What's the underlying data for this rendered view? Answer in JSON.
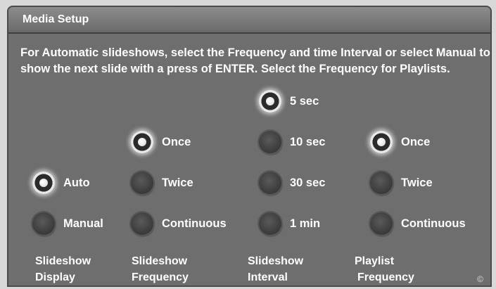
{
  "title": "Media Setup",
  "description": "For Automatic slideshows, select the Frequency and time Interval or select Manual to show the next slide with a press of ENTER. Select the Frequency for Playlists.",
  "columns": {
    "display": {
      "line1": "Slideshow",
      "line2": "Display"
    },
    "frequency": {
      "line1": "Slideshow",
      "line2": "Frequency"
    },
    "interval": {
      "line1": "Slideshow",
      "line2": "Interval"
    },
    "playlist": {
      "line1": "Playlist",
      "line2": "Frequency"
    }
  },
  "options": {
    "display": [
      {
        "label": "Auto",
        "selected": true
      },
      {
        "label": "Manual",
        "selected": false
      }
    ],
    "frequency": [
      {
        "label": "Once",
        "selected": true
      },
      {
        "label": "Twice",
        "selected": false
      },
      {
        "label": "Continuous",
        "selected": false
      }
    ],
    "interval": [
      {
        "label": "5 sec",
        "selected": true
      },
      {
        "label": "10 sec",
        "selected": false
      },
      {
        "label": "30 sec",
        "selected": false
      },
      {
        "label": "1 min",
        "selected": false
      }
    ],
    "playlist": [
      {
        "label": "Once",
        "selected": true
      },
      {
        "label": "Twice",
        "selected": false
      },
      {
        "label": "Continuous",
        "selected": false
      }
    ]
  },
  "corner_mark": "©"
}
